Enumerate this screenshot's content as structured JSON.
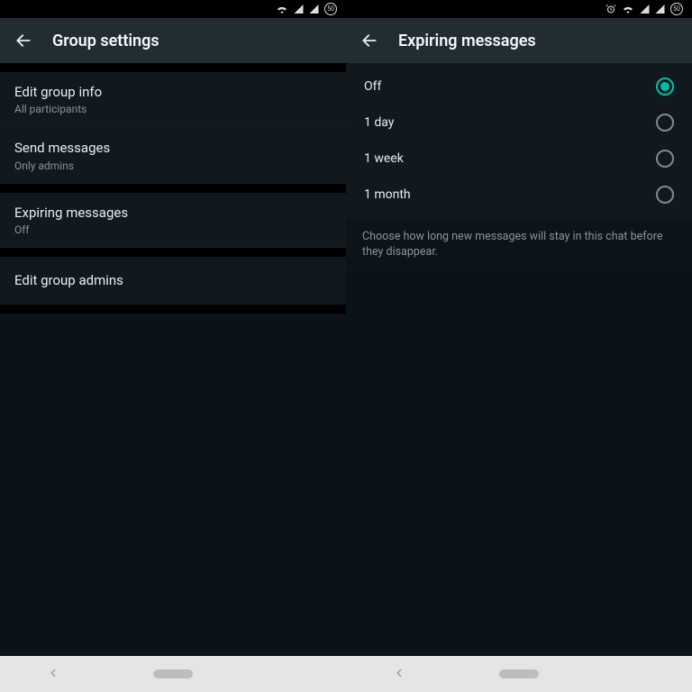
{
  "status": {
    "battery": "50"
  },
  "left": {
    "title": "Group settings",
    "items": {
      "edit_info": {
        "title": "Edit group info",
        "subtitle": "All participants"
      },
      "send_msgs": {
        "title": "Send messages",
        "subtitle": "Only admins"
      },
      "expiring": {
        "title": "Expiring messages",
        "subtitle": "Off"
      },
      "edit_admins": {
        "title": "Edit group admins"
      }
    }
  },
  "right": {
    "title": "Expiring messages",
    "options": {
      "off": "Off",
      "one_day": "1 day",
      "one_week": "1 week",
      "one_month": "1 month"
    },
    "helper": "Choose how long new messages will stay in this chat before they disappear."
  }
}
